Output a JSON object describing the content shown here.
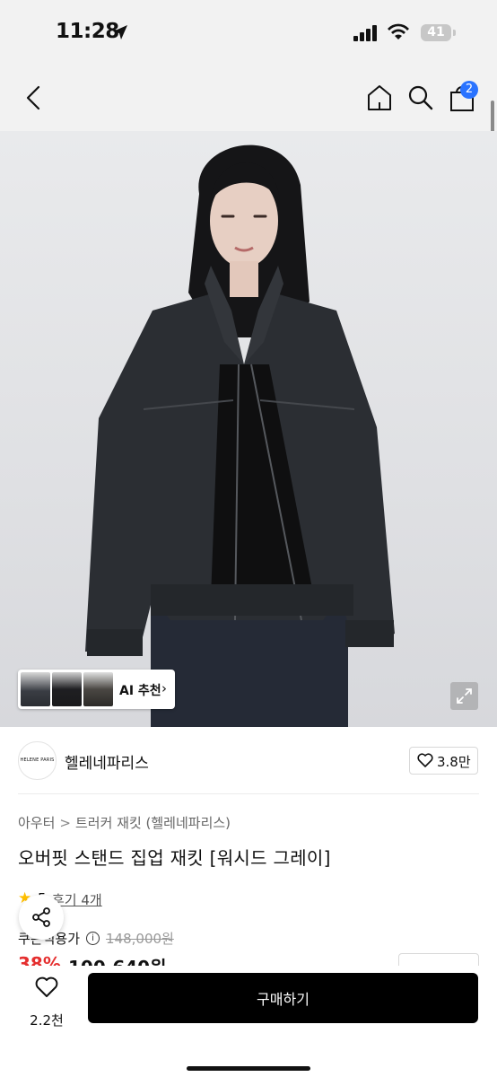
{
  "status_bar": {
    "time": "11:28",
    "battery": "41"
  },
  "header": {
    "cart_count": "2"
  },
  "recommend": {
    "label": "AI 추천",
    "chevron": "›"
  },
  "brand": {
    "logo_text": "HELENE PARIS",
    "name": "헬레네파리스",
    "likes": "3.8만"
  },
  "breadcrumb": {
    "category": "아우터",
    "separator": ">",
    "subcategory": "트러커 재킷 (헬레네파리스)"
  },
  "product": {
    "title": "오버핏 스탠드 집업 재킷 [워시드 그레이]"
  },
  "rating": {
    "value": "5",
    "reviews": "후기 4개"
  },
  "price": {
    "label": "쿠폰적용가",
    "info_icon": "i",
    "original": "148,000원",
    "discount": "38%",
    "sale": "100,640원"
  },
  "bottom": {
    "wish_count": "2.2천",
    "buy_label": "구매하기"
  },
  "colors": {
    "accent_blue": "#2a73ff",
    "sale_red": "#e52f2f",
    "star_yellow": "#ffbf00",
    "button_black": "#000000"
  },
  "icons": [
    "location-arrow-icon",
    "signal-icon",
    "wifi-icon",
    "battery-icon",
    "back-icon",
    "home-icon",
    "search-icon",
    "shopping-bag-icon",
    "expand-icon",
    "heart-icon",
    "star-icon",
    "share-icon",
    "info-icon"
  ]
}
